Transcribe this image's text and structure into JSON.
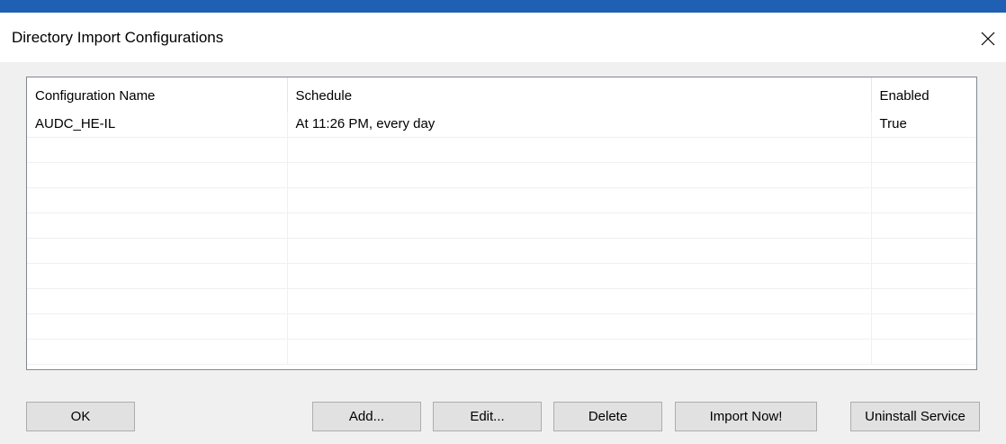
{
  "window": {
    "title": "Directory Import Configurations"
  },
  "table": {
    "columns": [
      "Configuration Name",
      "Schedule",
      "Enabled"
    ],
    "rows": [
      [
        "AUDC_HE-IL",
        "At 11:26 PM, every day",
        "True"
      ]
    ]
  },
  "buttons": {
    "ok": "OK",
    "add": "Add...",
    "edit": "Edit...",
    "delete": "Delete",
    "import_now": "Import Now!",
    "uninstall_service": "Uninstall Service"
  },
  "icons": {
    "close": "close-icon"
  },
  "colors": {
    "accent_bar": "#1f5fb4",
    "button_face": "#e1e1e1",
    "list_border": "#828790"
  }
}
